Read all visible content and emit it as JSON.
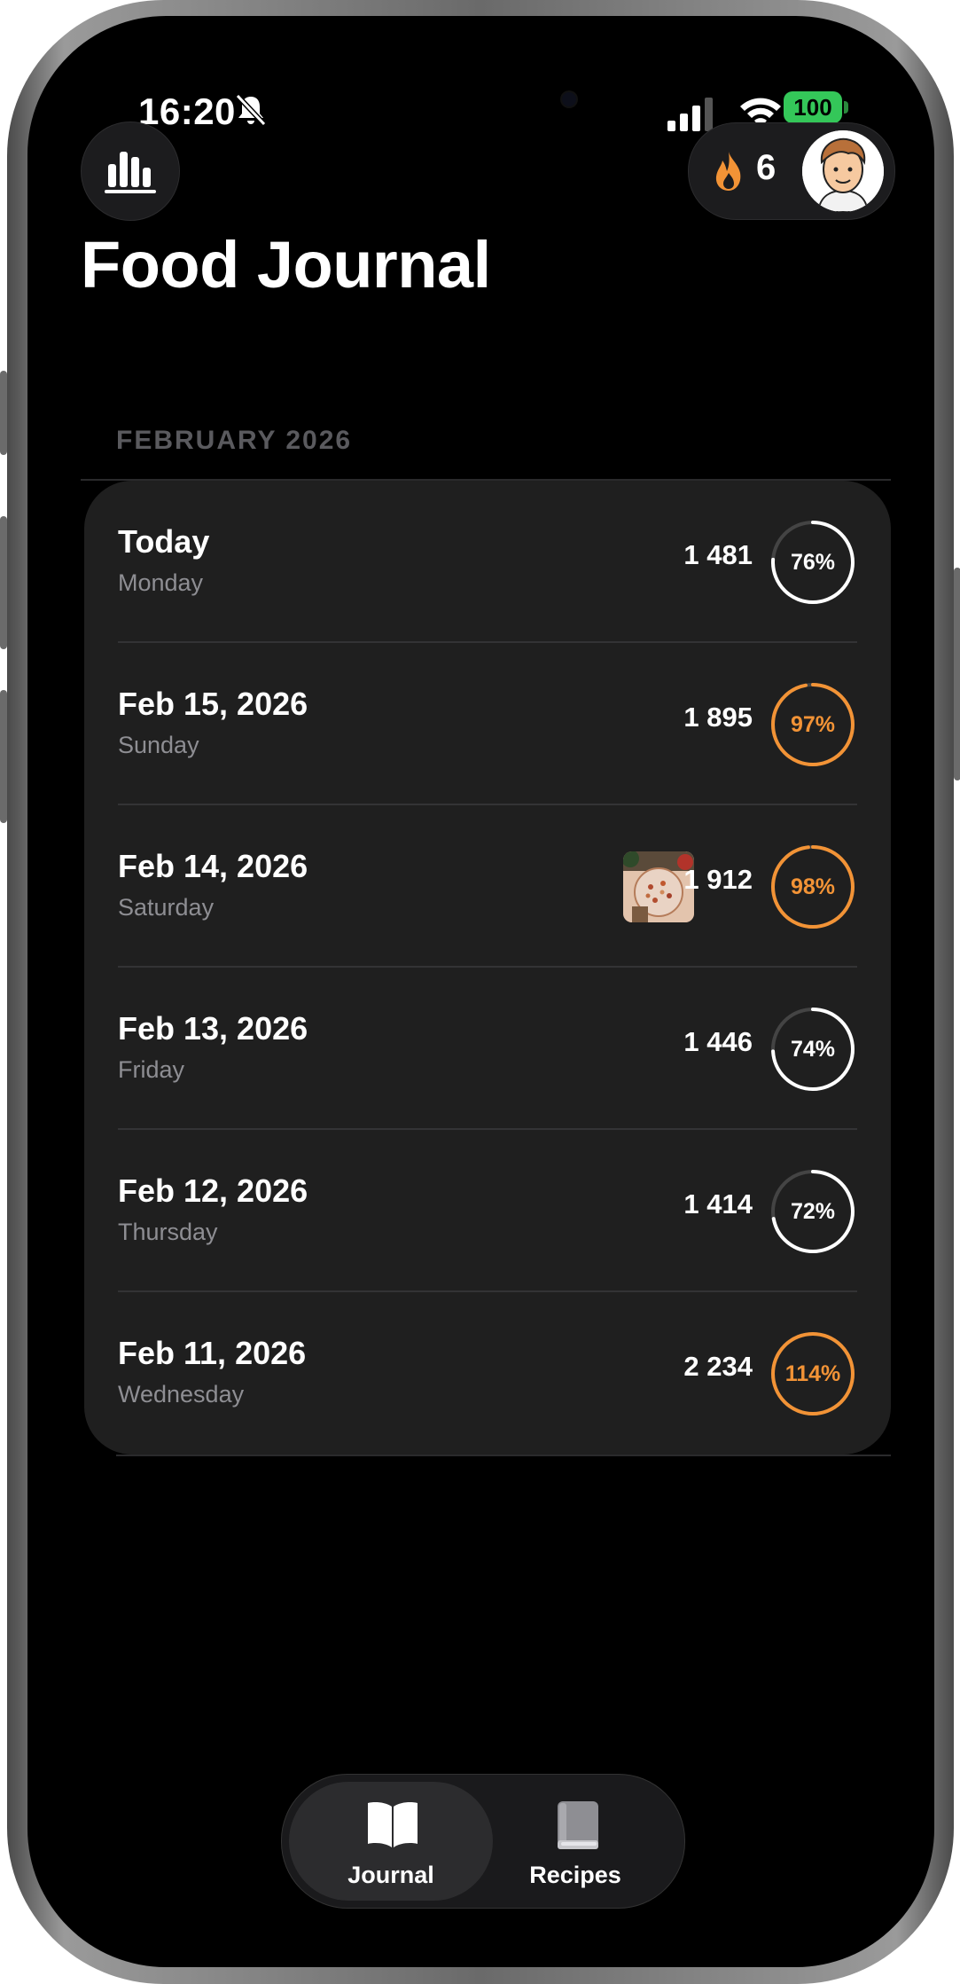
{
  "status_bar": {
    "time": "16:20",
    "battery": "100",
    "icons": [
      "bell-slash-icon",
      "signal-icon",
      "wifi-icon",
      "battery-icon"
    ]
  },
  "header": {
    "stats_icon": "bar-chart-icon",
    "streak_icon": "flame-icon",
    "streak_count": "6",
    "avatar_icon": "avatar"
  },
  "title": "Food Journal",
  "section": "FEBRUARY 2026",
  "entries": [
    {
      "date": "Today",
      "day": "Monday",
      "kcal": "1 481",
      "percent_label": "76%",
      "percent": 76,
      "accent": "#ffffff",
      "has_photo": false
    },
    {
      "date": "Feb 15, 2026",
      "day": "Sunday",
      "kcal": "1 895",
      "percent_label": "97%",
      "percent": 97,
      "accent": "#f29336",
      "has_photo": false
    },
    {
      "date": "Feb 14, 2026",
      "day": "Saturday",
      "kcal": "1 912",
      "percent_label": "98%",
      "percent": 98,
      "accent": "#f29336",
      "has_photo": true
    },
    {
      "date": "Feb 13, 2026",
      "day": "Friday",
      "kcal": "1 446",
      "percent_label": "74%",
      "percent": 74,
      "accent": "#ffffff",
      "has_photo": false
    },
    {
      "date": "Feb 12, 2026",
      "day": "Thursday",
      "kcal": "1 414",
      "percent_label": "72%",
      "percent": 72,
      "accent": "#ffffff",
      "has_photo": false
    },
    {
      "date": "Feb 11, 2026",
      "day": "Wednesday",
      "kcal": "2 234",
      "percent_label": "114%",
      "percent": 114,
      "accent": "#f29336",
      "has_photo": false
    }
  ],
  "tabs": [
    {
      "label": "Journal",
      "icon": "book-open-icon",
      "active": true
    },
    {
      "label": "Recipes",
      "icon": "book-closed-icon",
      "active": false
    }
  ],
  "colors": {
    "accent": "#f29336",
    "card": "#1f1f1f",
    "battery": "#34c759"
  }
}
